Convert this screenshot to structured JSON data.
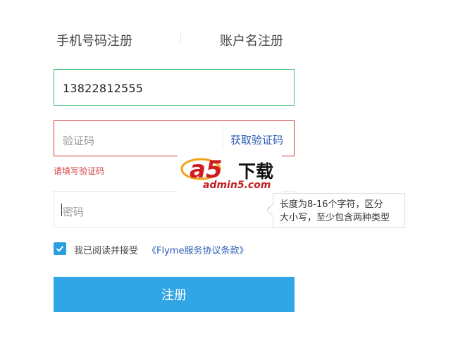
{
  "tabs": {
    "phone_register": "手机号码注册",
    "account_register": "账户名注册"
  },
  "phone": {
    "value": "13822812555"
  },
  "code": {
    "placeholder": "验证码",
    "get_code_label": "获取验证码",
    "error": "请填写验证码"
  },
  "password": {
    "placeholder": "密码",
    "tooltip_line1": "长度为8-16个字符，区分",
    "tooltip_line2": "大小写，至少包含两种类型"
  },
  "agreement": {
    "checked": true,
    "text": "我已阅读并接受",
    "link": "《Flyme服务协议条款》"
  },
  "submit_label": "注册",
  "watermark": {
    "logo_text": "a5",
    "brand": "下载",
    "url": "admin5.com"
  },
  "colors": {
    "valid_border": "#3fbf78",
    "error": "#d23d3d",
    "link": "#2a5ab4",
    "primary_button": "#32a5e6",
    "checkbox": "#2b9ee0"
  }
}
